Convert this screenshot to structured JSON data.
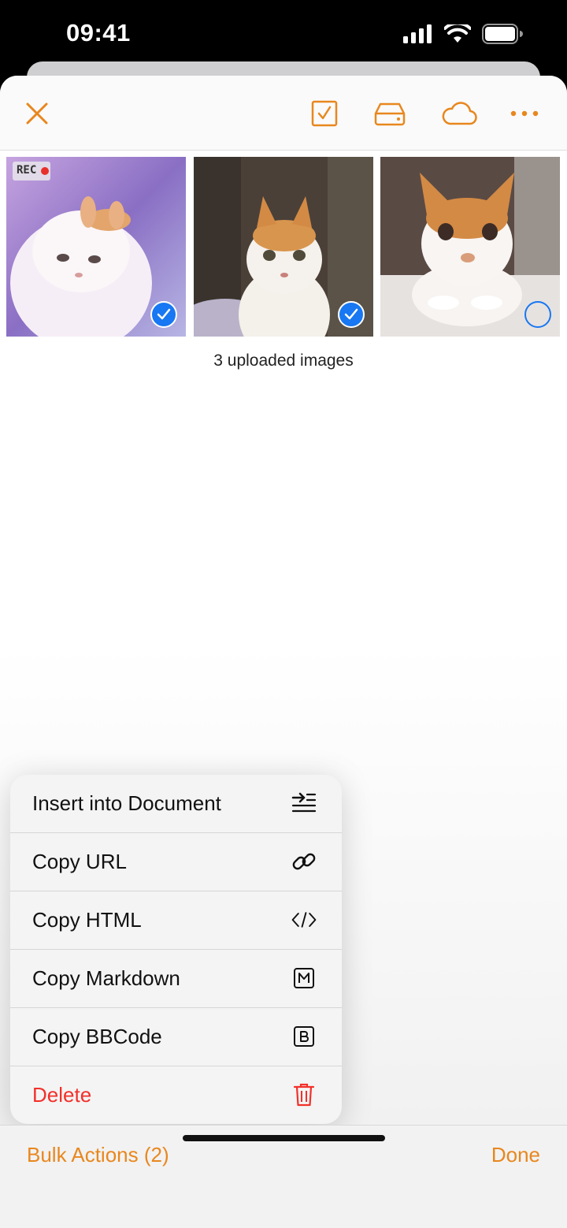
{
  "status": {
    "time": "09:41"
  },
  "toolbar": {
    "accent": "#e8871e",
    "icons": [
      "close-icon",
      "checkbox-icon",
      "drive-icon",
      "cloud-icon",
      "more-icon"
    ]
  },
  "gallery": {
    "images": [
      {
        "name": "cat-image-1",
        "selected": true,
        "overlay_badge": "REC"
      },
      {
        "name": "cat-image-2",
        "selected": true
      },
      {
        "name": "cat-image-3",
        "selected": false
      }
    ],
    "caption": "3 uploaded images"
  },
  "menu": {
    "items": [
      {
        "label": "Insert into Document",
        "icon": "insert-icon"
      },
      {
        "label": "Copy URL",
        "icon": "link-icon"
      },
      {
        "label": "Copy HTML",
        "icon": "code-icon"
      },
      {
        "label": "Copy Markdown",
        "icon": "markdown-icon"
      },
      {
        "label": "Copy BBCode",
        "icon": "bbcode-icon"
      },
      {
        "label": "Delete",
        "icon": "trash-icon",
        "color": "#f2302a"
      }
    ]
  },
  "bottom_bar": {
    "bulk_label": "Bulk Actions (2)",
    "done_label": "Done"
  }
}
